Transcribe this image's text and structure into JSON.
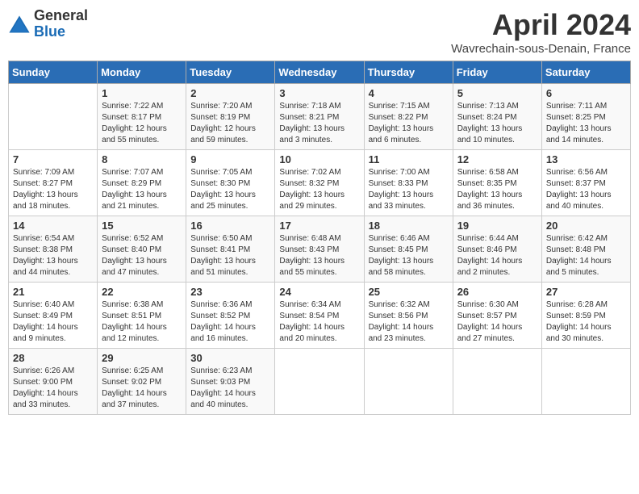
{
  "logo": {
    "general": "General",
    "blue": "Blue"
  },
  "title": "April 2024",
  "subtitle": "Wavrechain-sous-Denain, France",
  "days_header": [
    "Sunday",
    "Monday",
    "Tuesday",
    "Wednesday",
    "Thursday",
    "Friday",
    "Saturday"
  ],
  "weeks": [
    [
      {
        "day": "",
        "detail": ""
      },
      {
        "day": "1",
        "detail": "Sunrise: 7:22 AM\nSunset: 8:17 PM\nDaylight: 12 hours\nand 55 minutes."
      },
      {
        "day": "2",
        "detail": "Sunrise: 7:20 AM\nSunset: 8:19 PM\nDaylight: 12 hours\nand 59 minutes."
      },
      {
        "day": "3",
        "detail": "Sunrise: 7:18 AM\nSunset: 8:21 PM\nDaylight: 13 hours\nand 3 minutes."
      },
      {
        "day": "4",
        "detail": "Sunrise: 7:15 AM\nSunset: 8:22 PM\nDaylight: 13 hours\nand 6 minutes."
      },
      {
        "day": "5",
        "detail": "Sunrise: 7:13 AM\nSunset: 8:24 PM\nDaylight: 13 hours\nand 10 minutes."
      },
      {
        "day": "6",
        "detail": "Sunrise: 7:11 AM\nSunset: 8:25 PM\nDaylight: 13 hours\nand 14 minutes."
      }
    ],
    [
      {
        "day": "7",
        "detail": "Sunrise: 7:09 AM\nSunset: 8:27 PM\nDaylight: 13 hours\nand 18 minutes."
      },
      {
        "day": "8",
        "detail": "Sunrise: 7:07 AM\nSunset: 8:29 PM\nDaylight: 13 hours\nand 21 minutes."
      },
      {
        "day": "9",
        "detail": "Sunrise: 7:05 AM\nSunset: 8:30 PM\nDaylight: 13 hours\nand 25 minutes."
      },
      {
        "day": "10",
        "detail": "Sunrise: 7:02 AM\nSunset: 8:32 PM\nDaylight: 13 hours\nand 29 minutes."
      },
      {
        "day": "11",
        "detail": "Sunrise: 7:00 AM\nSunset: 8:33 PM\nDaylight: 13 hours\nand 33 minutes."
      },
      {
        "day": "12",
        "detail": "Sunrise: 6:58 AM\nSunset: 8:35 PM\nDaylight: 13 hours\nand 36 minutes."
      },
      {
        "day": "13",
        "detail": "Sunrise: 6:56 AM\nSunset: 8:37 PM\nDaylight: 13 hours\nand 40 minutes."
      }
    ],
    [
      {
        "day": "14",
        "detail": "Sunrise: 6:54 AM\nSunset: 8:38 PM\nDaylight: 13 hours\nand 44 minutes."
      },
      {
        "day": "15",
        "detail": "Sunrise: 6:52 AM\nSunset: 8:40 PM\nDaylight: 13 hours\nand 47 minutes."
      },
      {
        "day": "16",
        "detail": "Sunrise: 6:50 AM\nSunset: 8:41 PM\nDaylight: 13 hours\nand 51 minutes."
      },
      {
        "day": "17",
        "detail": "Sunrise: 6:48 AM\nSunset: 8:43 PM\nDaylight: 13 hours\nand 55 minutes."
      },
      {
        "day": "18",
        "detail": "Sunrise: 6:46 AM\nSunset: 8:45 PM\nDaylight: 13 hours\nand 58 minutes."
      },
      {
        "day": "19",
        "detail": "Sunrise: 6:44 AM\nSunset: 8:46 PM\nDaylight: 14 hours\nand 2 minutes."
      },
      {
        "day": "20",
        "detail": "Sunrise: 6:42 AM\nSunset: 8:48 PM\nDaylight: 14 hours\nand 5 minutes."
      }
    ],
    [
      {
        "day": "21",
        "detail": "Sunrise: 6:40 AM\nSunset: 8:49 PM\nDaylight: 14 hours\nand 9 minutes."
      },
      {
        "day": "22",
        "detail": "Sunrise: 6:38 AM\nSunset: 8:51 PM\nDaylight: 14 hours\nand 12 minutes."
      },
      {
        "day": "23",
        "detail": "Sunrise: 6:36 AM\nSunset: 8:52 PM\nDaylight: 14 hours\nand 16 minutes."
      },
      {
        "day": "24",
        "detail": "Sunrise: 6:34 AM\nSunset: 8:54 PM\nDaylight: 14 hours\nand 20 minutes."
      },
      {
        "day": "25",
        "detail": "Sunrise: 6:32 AM\nSunset: 8:56 PM\nDaylight: 14 hours\nand 23 minutes."
      },
      {
        "day": "26",
        "detail": "Sunrise: 6:30 AM\nSunset: 8:57 PM\nDaylight: 14 hours\nand 27 minutes."
      },
      {
        "day": "27",
        "detail": "Sunrise: 6:28 AM\nSunset: 8:59 PM\nDaylight: 14 hours\nand 30 minutes."
      }
    ],
    [
      {
        "day": "28",
        "detail": "Sunrise: 6:26 AM\nSunset: 9:00 PM\nDaylight: 14 hours\nand 33 minutes."
      },
      {
        "day": "29",
        "detail": "Sunrise: 6:25 AM\nSunset: 9:02 PM\nDaylight: 14 hours\nand 37 minutes."
      },
      {
        "day": "30",
        "detail": "Sunrise: 6:23 AM\nSunset: 9:03 PM\nDaylight: 14 hours\nand 40 minutes."
      },
      {
        "day": "",
        "detail": ""
      },
      {
        "day": "",
        "detail": ""
      },
      {
        "day": "",
        "detail": ""
      },
      {
        "day": "",
        "detail": ""
      }
    ]
  ]
}
